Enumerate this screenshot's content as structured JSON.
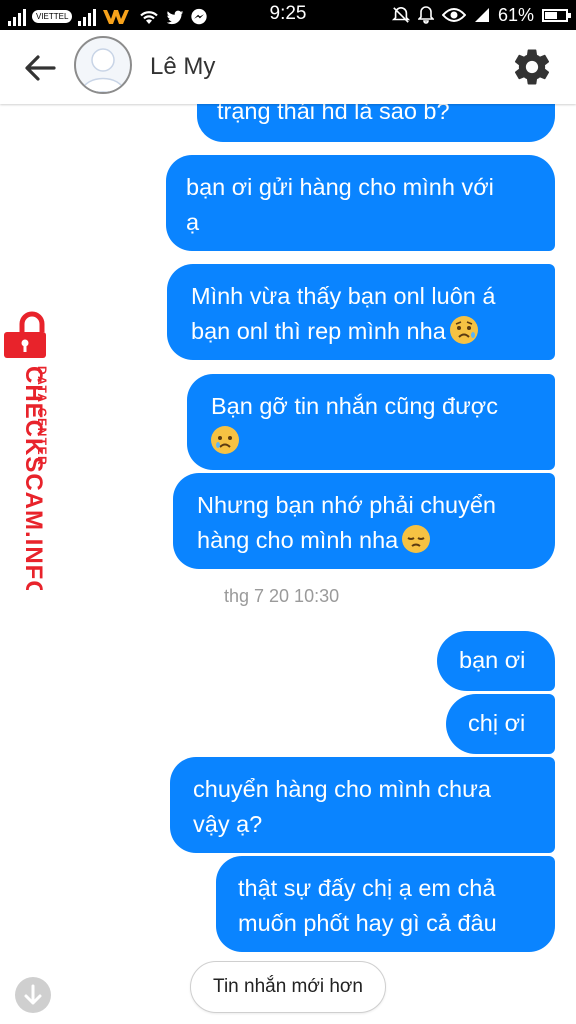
{
  "status_bar": {
    "time": "9:25",
    "battery": "61%",
    "battery_level": 0.61
  },
  "header": {
    "contact_name": "Lê My"
  },
  "messages": [
    {
      "text": "trạng thái hd là sao b?"
    },
    {
      "text": "bạn ơi gửi hàng cho mình với\nạ"
    },
    {
      "text": "Mình vừa thấy bạn onl luôn á\nbạn onl thì rep mình nha",
      "emoji": "sad-relieved-face"
    },
    {
      "text": "Bạn gỡ tin nhắn cũng được\n",
      "emoji": "crying-face"
    },
    {
      "text": "Nhưng bạn nhớ phải chuyển\nhàng cho mình nha",
      "emoji": "pensive-face"
    },
    {
      "text": "bạn ơi"
    },
    {
      "text": "chị ơi"
    },
    {
      "text": "chuyển hàng cho mình chưa\nvậy ạ?"
    },
    {
      "text": "thật sự đấy chị ạ em chả\nmuốn phốt hay gì cả đâu"
    }
  ],
  "timestamp": "thg 7 20 10:30",
  "watermark": {
    "line1": "DATA CENTER",
    "line2": "CHECKSCAM.INFO",
    "color": "#e8232b"
  },
  "newer_messages_button": "Tin nhắn mới hơn",
  "colors": {
    "bubble": "#0a84ff",
    "header_bg": "#ffffff",
    "status_bar": "#000000"
  }
}
